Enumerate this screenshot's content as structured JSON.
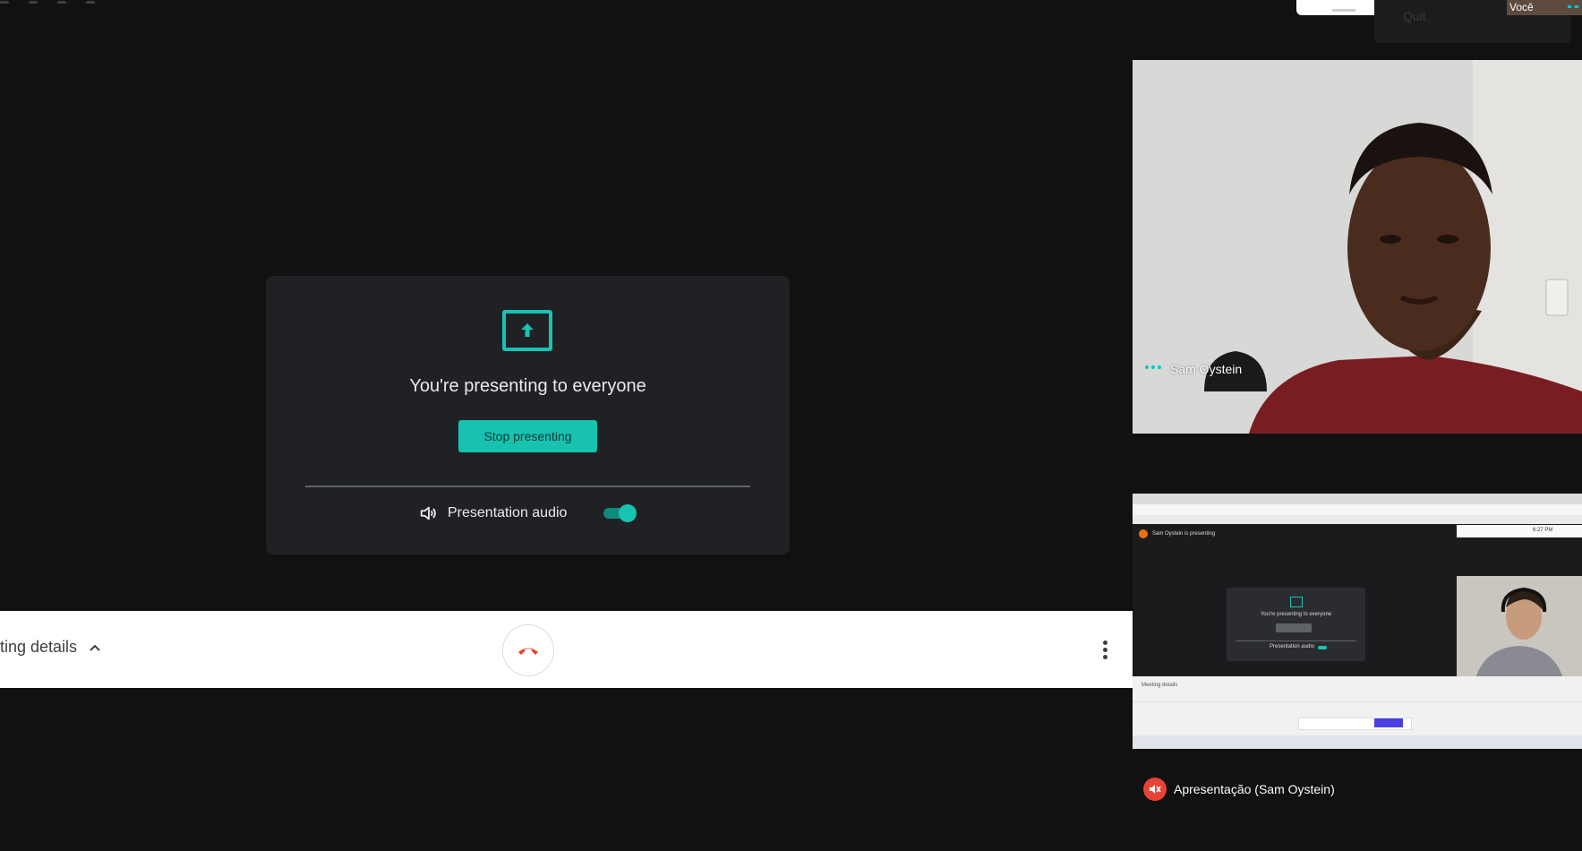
{
  "top": {
    "other_tile_name": "Você",
    "quit_label": "Quit"
  },
  "presentation": {
    "title": "You're presenting to everyone",
    "stop_button": "Stop presenting",
    "audio_label": "Presentation audio",
    "audio_enabled": true,
    "accent_color": "#18c2b0"
  },
  "bottom_bar": {
    "meeting_details_label": "ting details",
    "icons": [
      "chevron-up-icon",
      "hang-up-icon",
      "more-vert-icon"
    ]
  },
  "participants": {
    "speaker_name": "Sam Oystein",
    "presentation_tile_name": "Apresentação (Sam Oystein)"
  },
  "shared_screen_thumb": {
    "presenter_banner": "Sam Oystein is presenting",
    "card_title": "You're presenting to everyone",
    "audio_label": "Presentation audio",
    "meeting_details": "Meeting details",
    "time": "6:27 PM"
  },
  "colors": {
    "background": "#111112",
    "card": "#202124",
    "hangup": "#ea4335",
    "active_dots": "#00c8c8"
  }
}
